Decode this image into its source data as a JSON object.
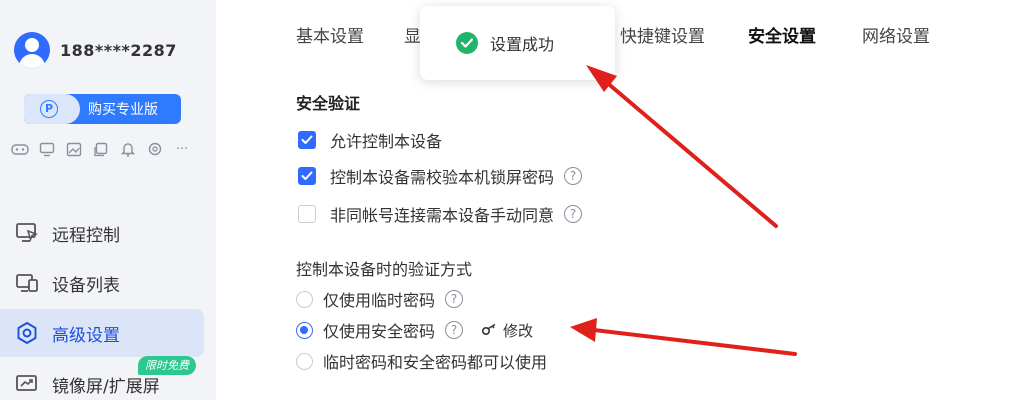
{
  "user": {
    "phone": "188****2287"
  },
  "pro_button": {
    "badge": "P",
    "label": "购买专业版"
  },
  "sidebar": {
    "mini_icons": [
      "gamepad-icon",
      "monitor-icon",
      "image-icon",
      "copy-icon",
      "bell-icon",
      "settings-icon",
      "more-icon"
    ],
    "more_glyph": "···",
    "items": [
      {
        "label": "远程控制",
        "icon": "remote-control-icon"
      },
      {
        "label": "设备列表",
        "icon": "devices-icon"
      },
      {
        "label": "高级设置",
        "icon": "gear-icon",
        "active": true
      },
      {
        "label": "镜像屏/扩展屏",
        "icon": "mirror-screen-icon",
        "badge": "限时免费"
      }
    ]
  },
  "tabs": [
    {
      "label": "基本设置"
    },
    {
      "label": "显"
    },
    {
      "label": "快捷键设置"
    },
    {
      "label": "安全设置",
      "active": true
    },
    {
      "label": "网络设置"
    }
  ],
  "toast": {
    "text": "设置成功",
    "icon": "success-check-icon"
  },
  "security": {
    "title": "安全验证",
    "options": [
      {
        "label": "允许控制本设备",
        "checked": true,
        "help": false
      },
      {
        "label": "控制本设备需校验本机锁屏密码",
        "checked": true,
        "help": true
      },
      {
        "label": "非同帐号连接需本设备手动同意",
        "checked": false,
        "help": true
      }
    ]
  },
  "verification": {
    "title": "控制本设备时的验证方式",
    "options": [
      {
        "label": "仅使用临时密码",
        "selected": false,
        "help": true
      },
      {
        "label": "仅使用安全密码",
        "selected": true,
        "help": true,
        "edit_label": "修改"
      },
      {
        "label": "临时密码和安全密码都可以使用",
        "selected": false,
        "help": false
      }
    ]
  },
  "help_glyph": "?",
  "colors": {
    "accent": "#2f6bff",
    "success": "#22b46c",
    "badge_green": "#2bc98e",
    "annotation_red": "#e0201b",
    "sidebar_bg": "#f2f4f8",
    "active_nav_bg": "#dce5f7"
  }
}
